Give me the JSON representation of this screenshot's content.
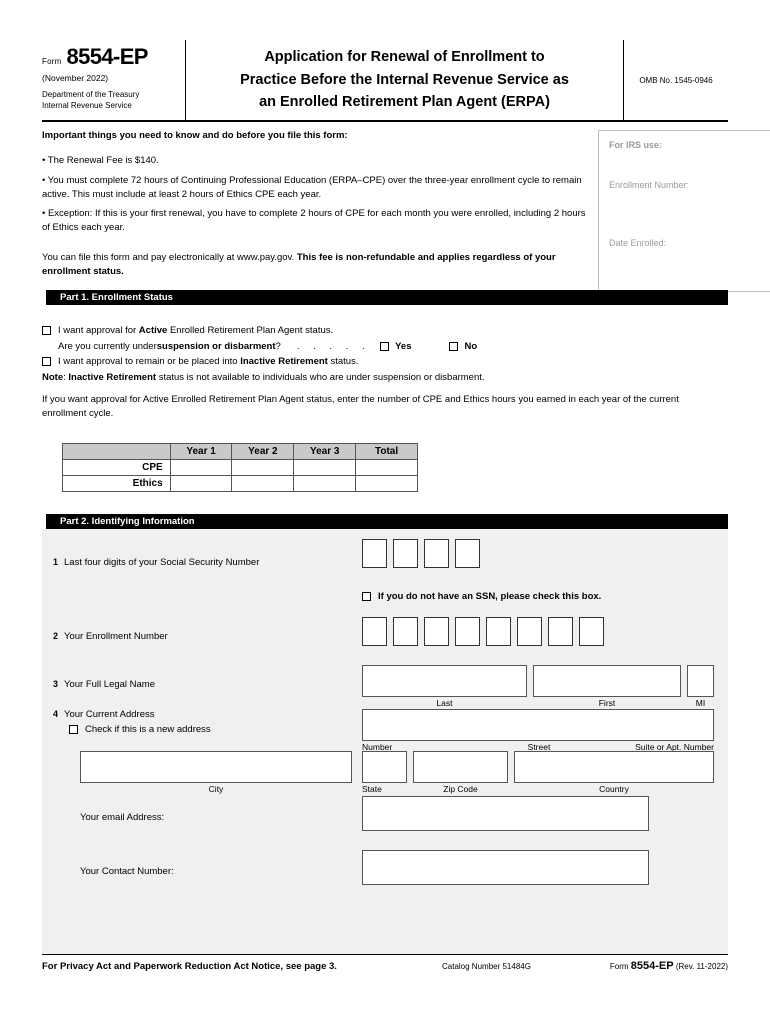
{
  "masthead": {
    "form_word": "Form",
    "form_number": "8554-EP",
    "revision_date": "(November 2022)",
    "department_line1": "Department of the Treasury",
    "department_line2": "Internal Revenue Service",
    "title_line1": "Application for Renewal of Enrollment to",
    "title_line2": "Practice Before the Internal Revenue Service as",
    "title_line3": "an Enrolled Retirement Plan Agent (ERPA)",
    "omb": "OMB No. 1545-0946"
  },
  "intro": {
    "lead": "Important things you need to know and do before you file this form:",
    "bullet1": "• The Renewal Fee is $140.",
    "bullet2": "• You must complete 72 hours of Continuing Professional Education (ERPA–CPE) over the three-year enrollment cycle to remain active. This must include at least 2 hours of Ethics CPE each year.",
    "bullet3": "• Exception: If this is your first renewal, you have to complete 2 hours of CPE for each month you were enrolled, including 2 hours of Ethics each year.",
    "closing_normal": "You can file this form and pay electronically at www.pay.gov. ",
    "closing_bold": "This fee is non-refundable and applies regardless of your enrollment status."
  },
  "irs_use": {
    "heading": "For IRS use:",
    "enrollment_number_label": "Enrollment Number:",
    "date_enrolled_label": "Date Enrolled:"
  },
  "part1": {
    "bar": "Part 1. Enrollment Status",
    "active_pre": "I want approval for ",
    "active_bold": "Active",
    "active_post": " Enrolled Retirement Plan Agent status.",
    "question_pre": "Are you currently under ",
    "question_bold": "suspension or disbarment",
    "question_post": "?",
    "dots": ". . . . .",
    "yes_label": "Yes",
    "no_label": "No",
    "inactive_pre": "I want approval to remain or be placed into ",
    "inactive_bold": "Inactive Retirement",
    "inactive_post": " status.",
    "note_label": "Note",
    "note_sep": ": ",
    "note_bold": "Inactive Retirement",
    "note_rest": " status is not available to individuals who are under suspension or disbarment.",
    "instruction": "If you want approval for Active Enrolled Retirement Plan Agent status, enter the number of CPE and Ethics hours you earned in each year of the current enrollment cycle."
  },
  "cpe_table": {
    "corner": "",
    "columns": [
      "Year 1",
      "Year 2",
      "Year 3",
      "Total"
    ],
    "rows": [
      {
        "label": "CPE",
        "values": [
          "",
          "",
          "",
          ""
        ]
      },
      {
        "label": "Ethics",
        "values": [
          "",
          "",
          "",
          ""
        ]
      }
    ]
  },
  "part2": {
    "bar": "Part 2. Identifying Information",
    "item1": {
      "num": "1",
      "label": "Last four digits of your Social Security Number",
      "digit_count": 4,
      "value": ""
    },
    "no_ssn": {
      "label": "If you do not have an SSN, please check this box.",
      "checked": false
    },
    "item2": {
      "num": "2",
      "label": "Your Enrollment Number",
      "digit_count": 8,
      "value": ""
    },
    "item3": {
      "num": "3",
      "label": "Your Full Legal Name",
      "captions": [
        "Last",
        "First",
        "MI"
      ],
      "values": [
        "",
        "",
        ""
      ]
    },
    "item4": {
      "num": "4",
      "label": "Your Current Address",
      "new_address_label": "Check if this is a new address",
      "new_address_checked": false,
      "line1_captions": [
        "Number",
        "Street",
        "Suite or Apt. Number"
      ],
      "line1_value": "",
      "city_caption": "City",
      "city_value": "",
      "state_caption": "State",
      "state_value": "",
      "zip_caption": "Zip Code",
      "zip_value": "",
      "country_caption": "Country",
      "country_value": ""
    },
    "email": {
      "label": "Your email Address:",
      "value": ""
    },
    "contact": {
      "label": "Your Contact Number:",
      "value": ""
    }
  },
  "footer": {
    "privacy": "For Privacy Act and Paperwork Reduction Act Notice, see page 3.",
    "catalog": "Catalog Number 51484G",
    "form_word": "Form",
    "form_number": "8554-EP",
    "rev": "(Rev. 11-2022)"
  }
}
